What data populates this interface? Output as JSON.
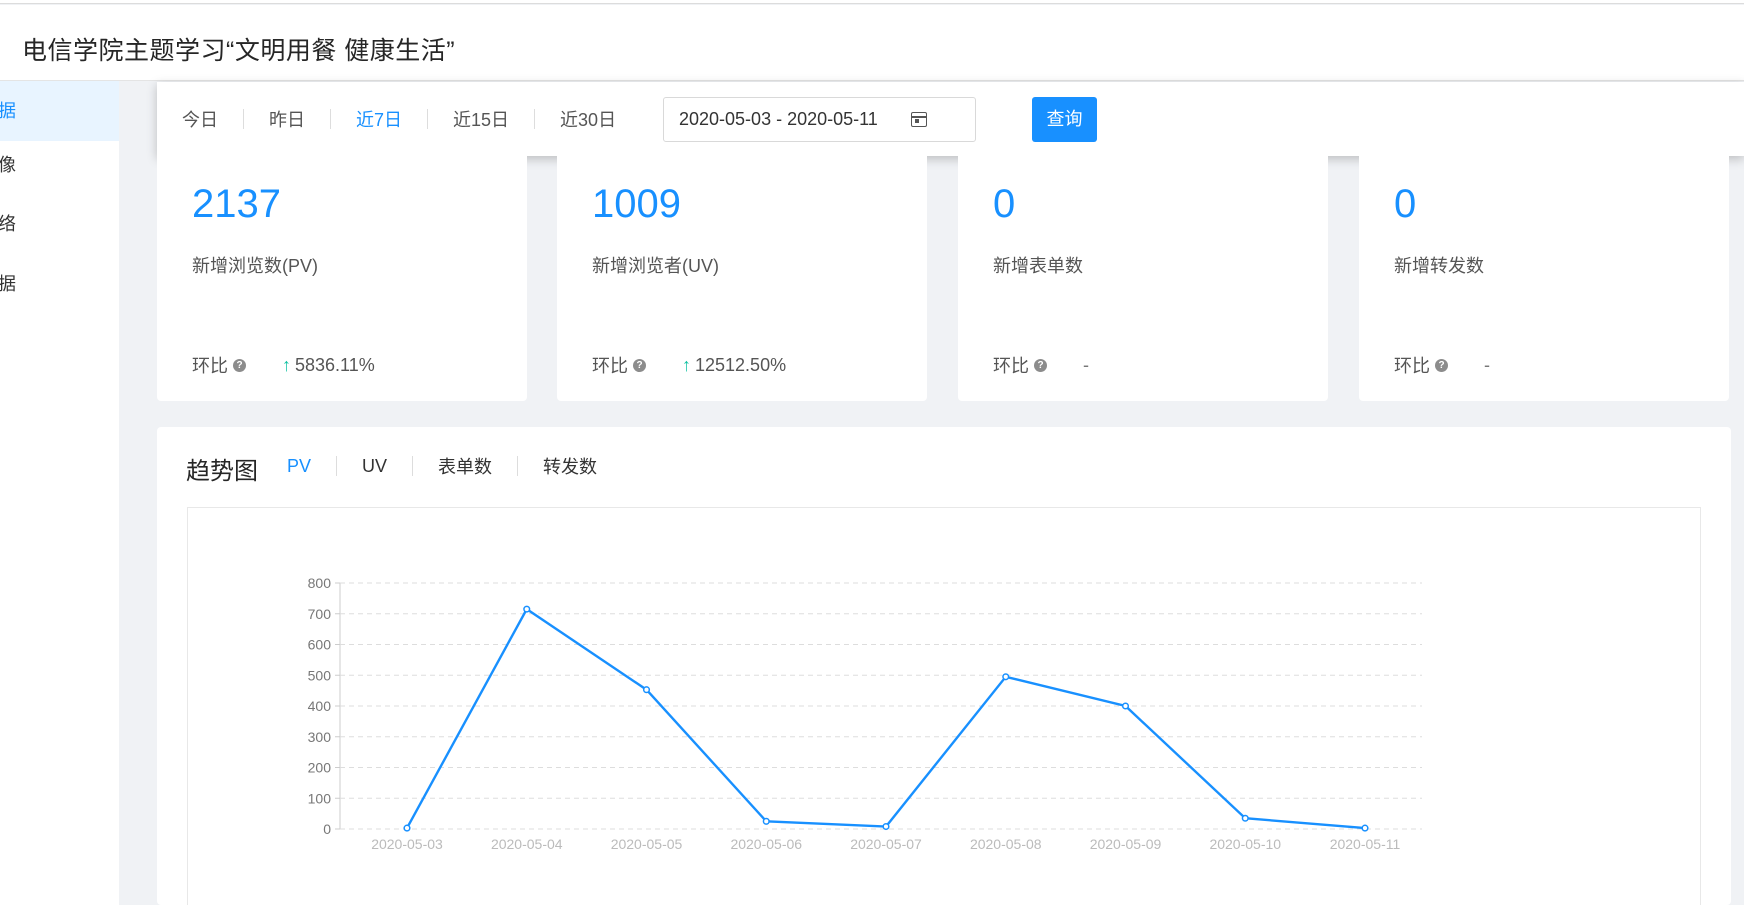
{
  "header": {
    "title": "电信学院主题学习“文明用餐 健康生活”"
  },
  "sidebar": {
    "items": [
      {
        "label": "据",
        "active": true
      },
      {
        "label": "像",
        "active": false
      },
      {
        "label": "络",
        "active": false
      },
      {
        "label": "据",
        "active": false
      }
    ]
  },
  "filter": {
    "tabs": [
      {
        "label": "今日"
      },
      {
        "label": "昨日"
      },
      {
        "label": "近7日",
        "active": true
      },
      {
        "label": "近15日"
      },
      {
        "label": "近30日"
      }
    ],
    "date_range": "2020-05-03 - 2020-05-11",
    "query_label": "查询"
  },
  "stats": [
    {
      "value": "2137",
      "label": "新增浏览数(PV)",
      "cmp_label": "环比",
      "cmp_value": "5836.11%",
      "trend": "up"
    },
    {
      "value": "1009",
      "label": "新增浏览者(UV)",
      "cmp_label": "环比",
      "cmp_value": "12512.50%",
      "trend": "up"
    },
    {
      "value": "0",
      "label": "新增表单数",
      "cmp_label": "环比",
      "cmp_value": "-",
      "trend": "none"
    },
    {
      "value": "0",
      "label": "新增转发数",
      "cmp_label": "环比",
      "cmp_value": "-",
      "trend": "none"
    }
  ],
  "trend": {
    "title": "趋势图",
    "tabs": [
      {
        "label": "PV",
        "active": true
      },
      {
        "label": "UV"
      },
      {
        "label": "表单数"
      },
      {
        "label": "转发数"
      }
    ]
  },
  "colors": {
    "accent": "#1890ff",
    "up": "#13c2a3"
  },
  "chart_data": {
    "type": "line",
    "categories": [
      "2020-05-03",
      "2020-05-04",
      "2020-05-05",
      "2020-05-06",
      "2020-05-07",
      "2020-05-08",
      "2020-05-09",
      "2020-05-10",
      "2020-05-11"
    ],
    "series": [
      {
        "values": [
          3,
          715,
          453,
          25,
          8,
          495,
          400,
          35,
          3
        ]
      }
    ],
    "yticks": [
      0,
      100,
      200,
      300,
      400,
      500,
      600,
      700,
      800
    ],
    "ylim": [
      0,
      800
    ],
    "grid": true,
    "color": "#1890ff"
  }
}
